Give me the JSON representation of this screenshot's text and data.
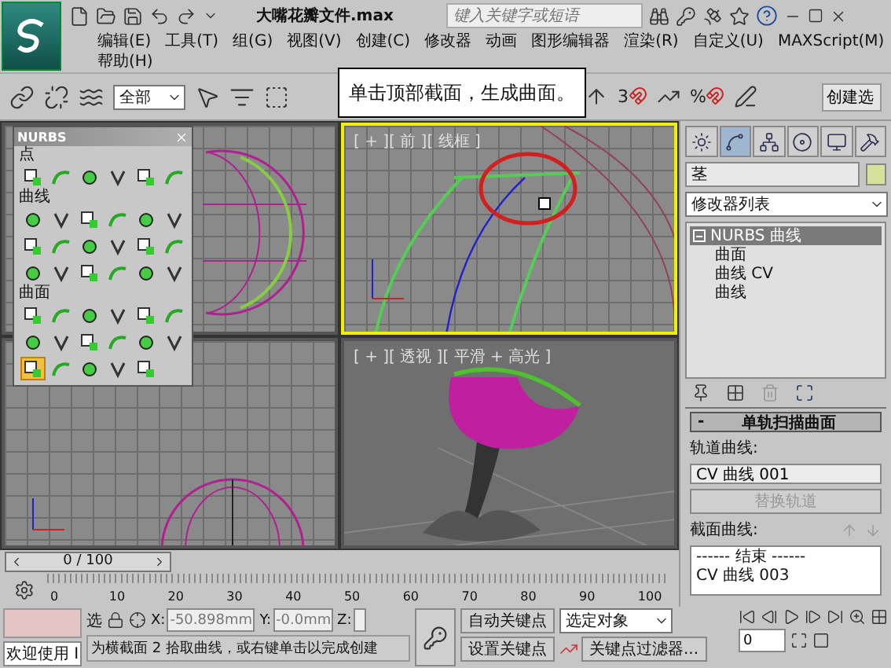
{
  "title_bar": {
    "file_name": "大嘴花瓣文件.max",
    "search": {
      "placeholder": "键入关键字或短语"
    }
  },
  "menu": [
    "编辑(E)",
    "工具(T)",
    "组(G)",
    "视图(V)",
    "创建(C)",
    "修改器",
    "动画",
    "图形编辑器",
    "渲染(R)",
    "自定义(U)",
    "MAXScript(M)",
    "帮助(H)"
  ],
  "toolbar": {
    "selection_filter": "全部",
    "snap_toggle": "3",
    "percent_snap": "%",
    "named_selection": "创建选"
  },
  "callout": "单击顶部截面，生成曲面。",
  "nurbs_panel": {
    "title": "NURBS",
    "sections": [
      {
        "title": "点",
        "tools": [
          {
            "selected": false
          },
          {
            "selected": false
          },
          {
            "selected": false
          },
          {
            "selected": false
          },
          {
            "selected": false
          },
          {
            "selected": false
          }
        ]
      },
      {
        "title": "曲线",
        "tools": [
          {
            "selected": false
          },
          {
            "selected": false
          },
          {
            "selected": false
          },
          {
            "selected": false
          },
          {
            "selected": false
          },
          {
            "selected": false
          },
          {
            "selected": false
          },
          {
            "selected": false
          },
          {
            "selected": false
          },
          {
            "selected": false
          },
          {
            "selected": false
          },
          {
            "selected": false
          },
          {
            "selected": false
          },
          {
            "selected": false
          },
          {
            "selected": false
          },
          {
            "selected": false
          },
          {
            "selected": false
          },
          {
            "selected": false
          }
        ]
      },
      {
        "title": "曲面",
        "tools": [
          {
            "selected": false
          },
          {
            "selected": false
          },
          {
            "selected": false
          },
          {
            "selected": false
          },
          {
            "selected": false
          },
          {
            "selected": false
          },
          {
            "selected": false
          },
          {
            "selected": false
          },
          {
            "selected": false
          },
          {
            "selected": false
          },
          {
            "selected": false
          },
          {
            "selected": false
          },
          {
            "selected": true
          },
          {
            "selected": false
          },
          {
            "selected": false
          },
          {
            "selected": false
          },
          {
            "selected": false
          }
        ]
      }
    ]
  },
  "viewports": [
    {
      "kind": "sphere-top",
      "active": false
    },
    {
      "kind": "curves",
      "label": "[ + ][ 前 ][ 线框 ]",
      "active": true
    },
    {
      "kind": "sphere-bottom",
      "active": false
    },
    {
      "kind": "flower",
      "label": "[ + ][ 透视 ][ 平滑 + 高光 ]",
      "active": false
    }
  ],
  "time_slider": {
    "label": "0 / 100",
    "level": 0
  },
  "track_labels": [
    "0",
    "10",
    "20",
    "30",
    "40",
    "50",
    "60",
    "70",
    "80",
    "90",
    "100"
  ],
  "command_panel": {
    "tabs": [
      {
        "selected": false
      },
      {
        "selected": true
      },
      {
        "selected": false
      },
      {
        "selected": false
      },
      {
        "selected": false
      },
      {
        "selected": false
      }
    ],
    "object_name": "茎",
    "modifier_list": "修改器列表",
    "stack": [
      {
        "label": "NURBS 曲线",
        "selected": true,
        "expanded": true,
        "children": [
          {
            "label": "曲面",
            "selected": false
          },
          {
            "label": "曲线 CV",
            "selected": false
          },
          {
            "label": "曲线",
            "selected": false
          }
        ]
      }
    ],
    "rollout": {
      "toggle": "-",
      "title": "单轨扫描曲面",
      "rail_label": "轨道曲线:",
      "rail_value": "CV 曲线 001",
      "replace_button": {
        "label": "替换轨道",
        "disabled": true
      },
      "section_label": "截面曲线:",
      "sections": [
        "------ 结束 ------",
        "CV 曲线 003"
      ]
    }
  },
  "status": {
    "listener": "欢迎使用 I",
    "lock_label": "选",
    "coords": [
      {
        "label": "X:",
        "value": "-50.898mm"
      },
      {
        "label": "Y:",
        "value": "-0.0mm"
      },
      {
        "label": "Z:"
      }
    ],
    "prompt": "为横截面 2 拾取曲线，或右键单击以完成创建"
  },
  "animation": {
    "auto_key": "自动关键点",
    "set_key": "设置关键点",
    "key_mode": "选定对象",
    "key_filters": "关键点过滤器...",
    "frame": "0"
  }
}
